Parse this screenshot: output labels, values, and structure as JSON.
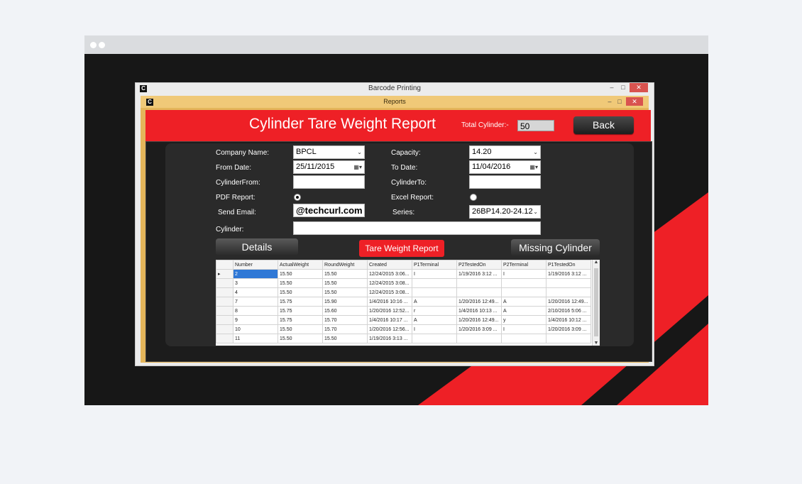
{
  "outer_window": {
    "title": "Barcode Printing",
    "logo": "C",
    "controls": [
      "–",
      "□",
      "✕"
    ]
  },
  "inner_window": {
    "title": "Reports",
    "logo": "C",
    "controls": [
      "–",
      "□",
      "✕"
    ]
  },
  "header": {
    "title": "Cylinder Tare Weight Report",
    "total_label": "Total Cylinder:-",
    "total_value": "50",
    "back_label": "Back"
  },
  "form": {
    "company_label": "Company Name:",
    "company_value": "BPCL",
    "from_label": "From Date:",
    "from_value": "25/11/2015",
    "cyl_from_label": "CylinderFrom:",
    "cyl_from_value": "",
    "pdf_label": "PDF Report:",
    "pdf_checked": true,
    "email_label": "Send Email:",
    "email_value": "@techcurl.com",
    "cylinder_label": "Cylinder:",
    "cylinder_value": "",
    "capacity_label": "Capacity:",
    "capacity_value": "14.20",
    "to_label": "To Date:",
    "to_value": "11/04/2016",
    "cyl_to_label": "CylinderTo:",
    "cyl_to_value": "",
    "excel_label": "Excel Report:",
    "excel_checked": false,
    "series_label": "Series:",
    "series_value": "26BP14.20-24.12"
  },
  "buttons": {
    "details": "Details",
    "tare": "Tare Weight Report",
    "missing": "Missing Cylinder"
  },
  "grid": {
    "columns": [
      "Number",
      "ActualWeight",
      "RoundWeight",
      "Created",
      "P1Terminal",
      "P2TestedOn",
      "P2Terminal",
      "P1TestedOn"
    ],
    "rows": [
      [
        "2",
        "15.50",
        "15.50",
        "12/24/2015 3:06...",
        "I",
        "1/19/2016 3:12 ...",
        "I",
        "1/19/2016 3:12 ..."
      ],
      [
        "3",
        "15.50",
        "15.50",
        "12/24/2015 3:08...",
        "",
        "",
        "",
        ""
      ],
      [
        "4",
        "15.50",
        "15.50",
        "12/24/2015 3:08...",
        "",
        "",
        "",
        ""
      ],
      [
        "7",
        "15.75",
        "15.90",
        "1/4/2016 10:16 ...",
        "A",
        "1/20/2016 12:49...",
        "A",
        "1/20/2016 12:49..."
      ],
      [
        "8",
        "15.75",
        "15.60",
        "1/20/2016 12:52...",
        "r",
        "1/4/2016 10:13 ...",
        "A",
        "2/10/2016 5:06 ..."
      ],
      [
        "9",
        "15.75",
        "15.70",
        "1/4/2016 10:17 ...",
        "A",
        "1/20/2016 12:49...",
        "y",
        "1/4/2016 10:12 ..."
      ],
      [
        "10",
        "15.50",
        "15.70",
        "1/20/2016 12:56...",
        "I",
        "1/20/2016 3:09 ...",
        "I",
        "1/20/2016 3:09 ..."
      ],
      [
        "11",
        "15.50",
        "15.50",
        "1/19/2016 3:13 ...",
        "",
        "",
        "",
        ""
      ]
    ]
  },
  "colors": {
    "red": "#ee2026",
    "gold": "#e4b55a",
    "dark": "#1c1c1c"
  }
}
